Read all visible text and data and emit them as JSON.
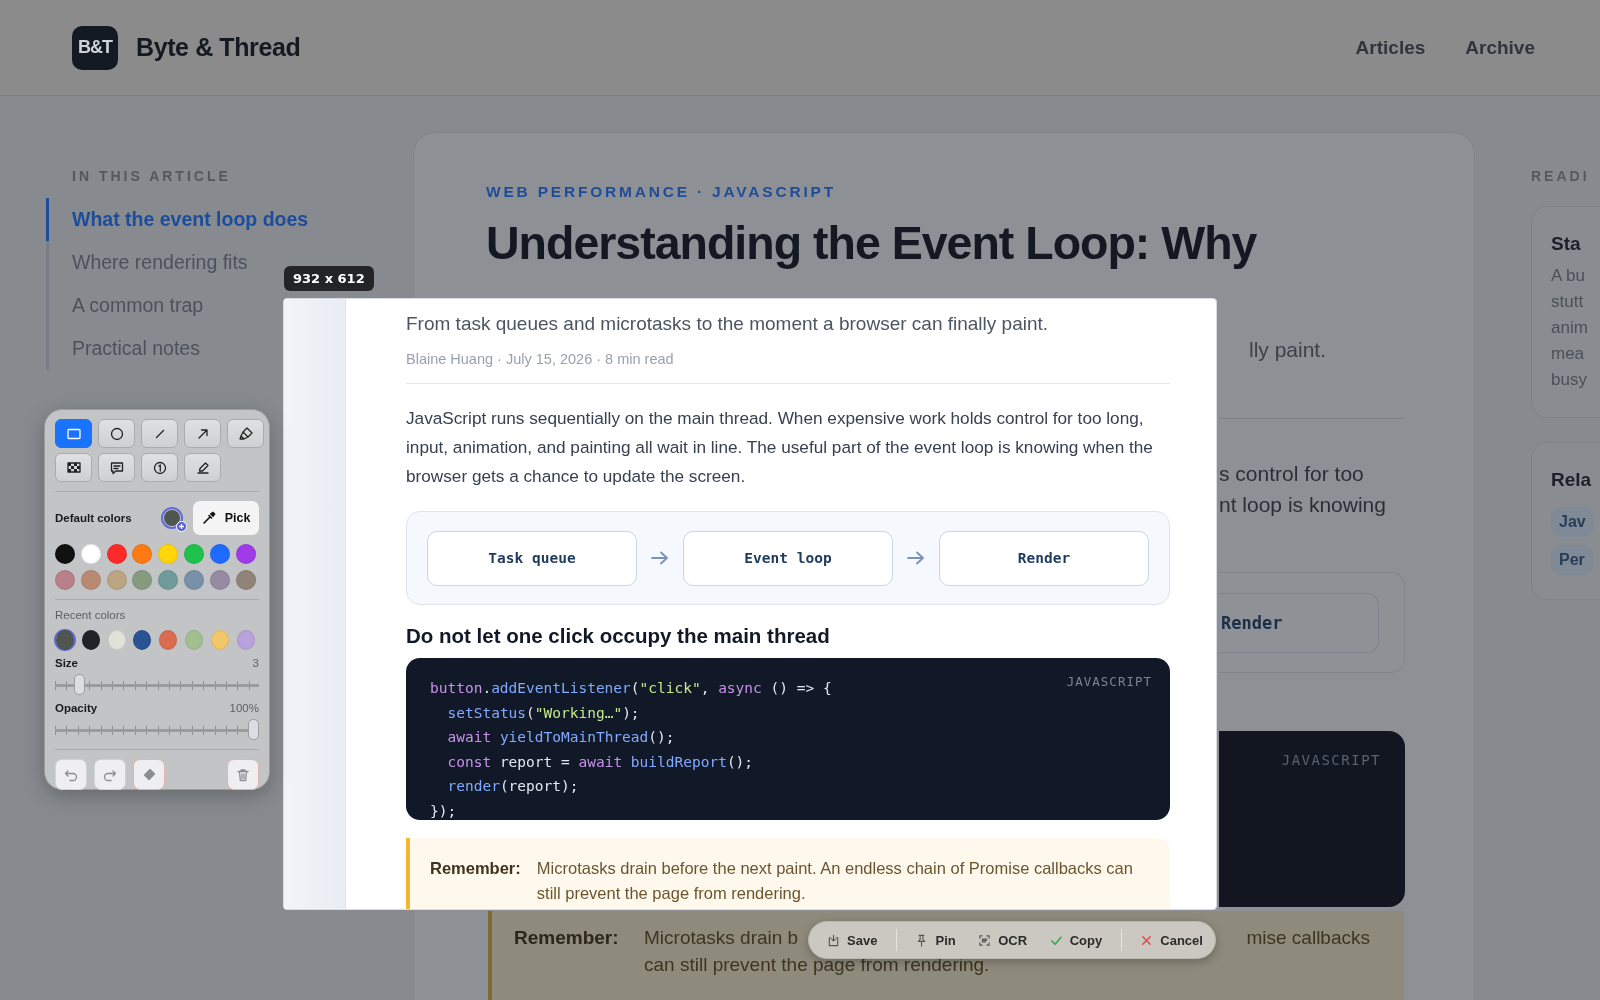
{
  "header": {
    "logo": "B&T",
    "site_name": "Byte & Thread",
    "nav": [
      {
        "label": "Articles"
      },
      {
        "label": "Archive"
      }
    ]
  },
  "toc": {
    "heading": "IN THIS ARTICLE",
    "items": [
      {
        "label": "What the event loop does",
        "selected": true
      },
      {
        "label": "Where rendering fits",
        "selected": false
      },
      {
        "label": "A common trap",
        "selected": false
      },
      {
        "label": "Practical notes",
        "selected": false
      }
    ]
  },
  "article": {
    "category": "WEB PERFORMANCE · JAVASCRIPT",
    "title_lines": [
      "Understanding the Event Loop: Why"
    ],
    "peek": {
      "subtitle_end": "lly paint.",
      "body_ends": [
        "s control for too",
        "nt loop is knowing"
      ],
      "flow_step": "Render",
      "code_language": "JAVASCRIPT"
    },
    "callout": {
      "label": "Remember:",
      "line_1_start": "Microtasks drain b",
      "line_1_end": "mise callbacks",
      "line_2": "can still prevent the page from rendering."
    }
  },
  "sidebar": {
    "heading": "READI",
    "cards": [
      {
        "title": "Sta",
        "lines": [
          "A bu",
          "stutt",
          "anim",
          "mea",
          "busy"
        ]
      },
      {
        "title": "Rela",
        "tags": [
          "Jav",
          "Per"
        ]
      }
    ]
  },
  "capture": {
    "size_label": "932 x 612",
    "subtitle": "From task queues and microtasks to the moment a browser can finally paint.",
    "meta": "Blaine Huang · July 15, 2026 · 8 min read",
    "paragraph": "JavaScript runs sequentially on the main thread. When expensive work holds control for too long, input, animation, and painting all wait in line. The useful part of the event loop is knowing when the browser gets a chance to update the screen.",
    "flow": [
      "Task queue",
      "Event loop",
      "Render"
    ],
    "heading": "Do not let one click occupy the main thread",
    "code": {
      "language": "JAVASCRIPT",
      "lines": [
        {
          "tokens": [
            {
              "text": "button",
              "kind": "keyword"
            },
            {
              "text": ".",
              "kind": "plain"
            },
            {
              "text": "addEventListener",
              "kind": "function"
            },
            {
              "text": "(",
              "kind": "plain"
            },
            {
              "text": "\"click\"",
              "kind": "string"
            },
            {
              "text": ", ",
              "kind": "plain"
            },
            {
              "text": "async",
              "kind": "keyword"
            },
            {
              "text": " () => {",
              "kind": "plain"
            }
          ],
          "children": [
            {
              "tokens": [
                {
                  "text": "setStatus",
                  "kind": "function"
                },
                {
                  "text": "(",
                  "kind": "plain"
                },
                {
                  "text": "\"Working…\"",
                  "kind": "string"
                },
                {
                  "text": ");",
                  "kind": "plain"
                }
              ]
            },
            {
              "tokens": [
                {
                  "text": "await",
                  "kind": "keyword"
                },
                {
                  "text": " yieldToMainThread",
                  "kind": "function"
                },
                {
                  "text": "();",
                  "kind": "plain"
                }
              ]
            },
            {
              "tokens": [
                {
                  "text": "const",
                  "kind": "keyword"
                },
                {
                  "text": " report = ",
                  "kind": "plain"
                },
                {
                  "text": "await",
                  "kind": "keyword"
                },
                {
                  "text": " buildReport",
                  "kind": "function"
                },
                {
                  "text": "();",
                  "kind": "plain"
                }
              ]
            },
            {
              "tokens": [
                {
                  "text": "render",
                  "kind": "function"
                },
                {
                  "text": "(report);",
                  "kind": "plain"
                }
              ]
            }
          ]
        },
        {
          "tokens": [
            {
              "text": "});",
              "kind": "plain"
            }
          ]
        }
      ]
    },
    "callout": {
      "label": "Remember:",
      "text": "Microtasks drain before the next paint. An endless chain of Promise callbacks can still prevent the page from rendering."
    }
  },
  "annotation_panel": {
    "tools": [
      {
        "kind": "rectangle",
        "selected": true
      },
      {
        "kind": "circle",
        "selected": false
      },
      {
        "kind": "line",
        "selected": false
      },
      {
        "kind": "arrow",
        "selected": false
      },
      {
        "kind": "marker",
        "selected": false
      },
      {
        "kind": "mosaic",
        "selected": false
      },
      {
        "kind": "text",
        "selected": false
      },
      {
        "kind": "counter",
        "selected": false
      },
      {
        "kind": "pen",
        "selected": false
      }
    ],
    "default_label": "Default colors",
    "current_swatch": {
      "color": "#4f5650"
    },
    "pick_label": "Pick",
    "palette": [
      {
        "color": "#111111"
      },
      {
        "color": "#ffffff"
      },
      {
        "color": "#ff2a2a"
      },
      {
        "color": "#ff7a12"
      },
      {
        "color": "#ffd60a"
      },
      {
        "color": "#1fc24a"
      },
      {
        "color": "#1f6bff"
      },
      {
        "color": "#a13bea"
      },
      {
        "color": "#b9808a"
      },
      {
        "color": "#b98a72"
      },
      {
        "color": "#bba583"
      },
      {
        "color": "#869a80"
      },
      {
        "color": "#6f9c9a"
      },
      {
        "color": "#7890a8"
      },
      {
        "color": "#978aa3"
      },
      {
        "color": "#8f8477"
      }
    ],
    "recent_label": "Recent colors",
    "recent": [
      {
        "color": "#4f5650",
        "selected": true
      },
      {
        "color": "#1f2228",
        "selected": false
      },
      {
        "color": "#e1e3d8",
        "selected": false
      },
      {
        "color": "#2a5394",
        "selected": false
      },
      {
        "color": "#d96b4f",
        "selected": false
      },
      {
        "color": "#a2bf90",
        "selected": false
      },
      {
        "color": "#f2c76a",
        "selected": false
      },
      {
        "color": "#b9a1dc",
        "selected": false
      }
    ],
    "sliders": [
      {
        "label": "Size",
        "reading": "3",
        "level": 0.1
      },
      {
        "label": "Opacity",
        "reading": "100%",
        "level": 1
      }
    ],
    "footer": [
      {
        "kind": "undo"
      },
      {
        "kind": "redo"
      },
      {
        "kind": "eraser"
      },
      {
        "kind": "trash"
      }
    ]
  },
  "action_bar": [
    {
      "kind": "save",
      "label": "Save"
    },
    {
      "kind": "pin",
      "label": "Pin"
    },
    {
      "kind": "ocr",
      "label": "OCR"
    },
    {
      "kind": "copy",
      "label": "Copy"
    },
    {
      "kind": "cancel",
      "label": "Cancel"
    }
  ]
}
